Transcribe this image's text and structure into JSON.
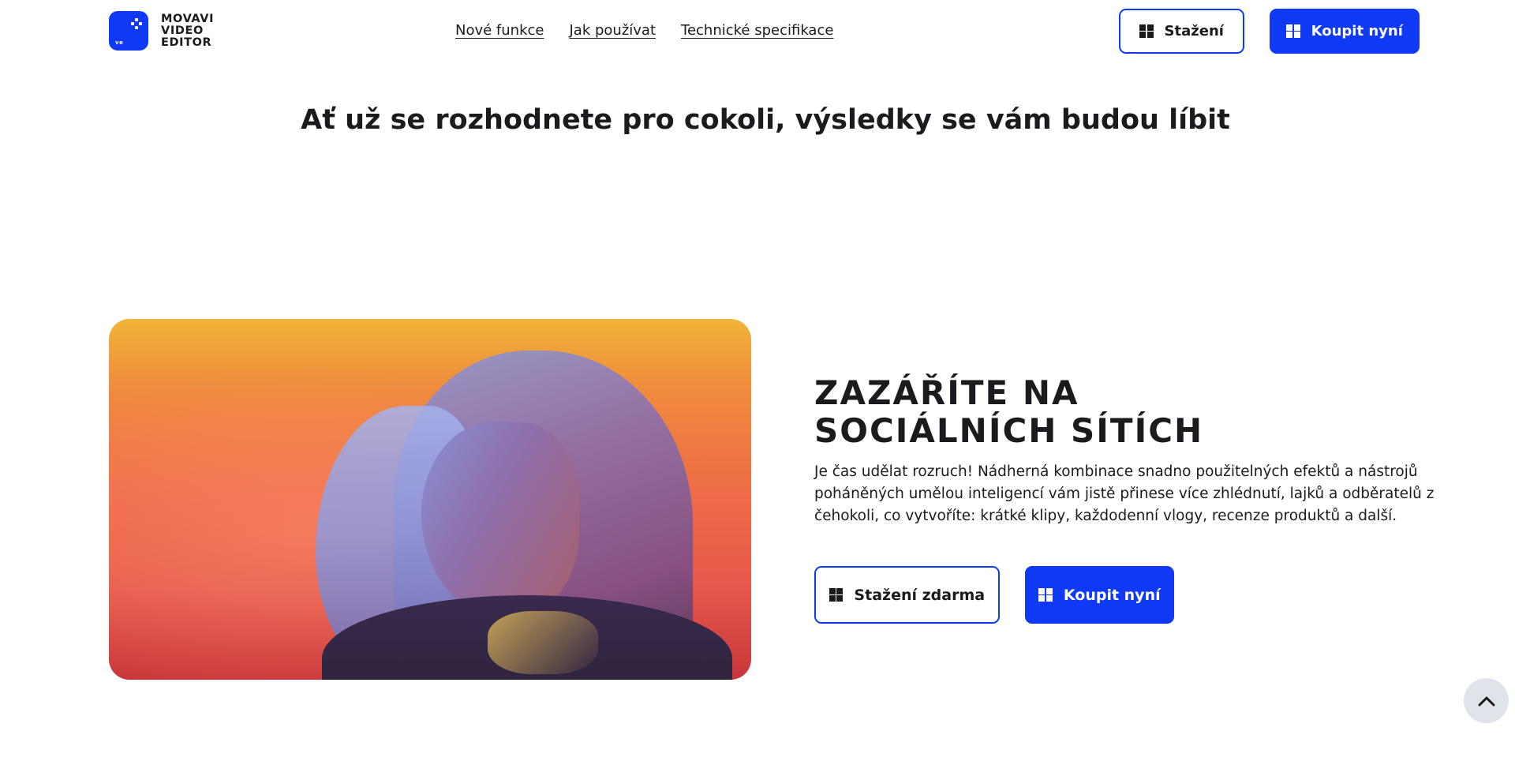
{
  "header": {
    "logo_lines": [
      "MOVAVI",
      "VIDEO",
      "EDITOR"
    ],
    "logo_badge": "ve",
    "nav": [
      {
        "label": "Nové funkce"
      },
      {
        "label": "Jak používat"
      },
      {
        "label": "Technické specifikace"
      }
    ],
    "download_label": "Stažení",
    "buy_label": "Koupit nyní"
  },
  "section": {
    "title": "Ať už se rozhodnete pro cokoli, výsledky se vám budou líbit"
  },
  "feature": {
    "heading_lines": [
      "ZAZÁŘÍTE NA",
      "SOCIÁLNÍCH SÍTÍCH"
    ],
    "description": "Je čas udělat rozruch! Nádherná kombinace snadno použitelných efektů a nástrojů poháněných umělou inteligencí vám jistě přinese více zhlédnutí, lajků a odběratelů z čehokoli, co vytvoříte: krátké klipy, každodenní vlogy, recenze produktů a další.",
    "download_label": "Stažení zdarma",
    "buy_label": "Koupit nyní"
  },
  "icons": {
    "platform": "windows-icon",
    "scroll": "chevron-up-icon"
  },
  "colors": {
    "accent": "#0f39f5",
    "text": "#1a1a1f",
    "scroll_bg": "#dfe3ea"
  }
}
